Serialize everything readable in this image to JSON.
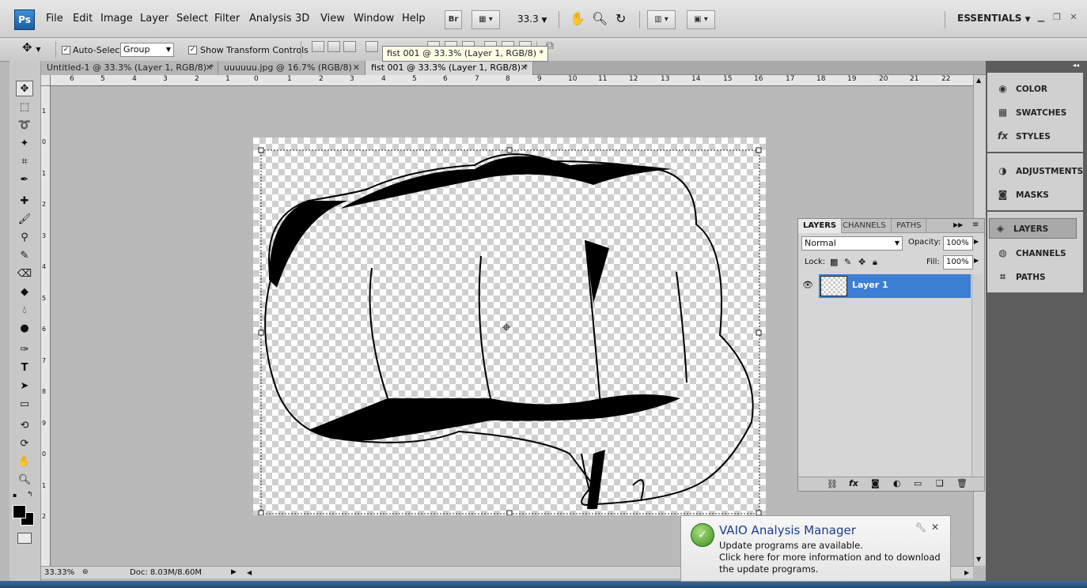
{
  "app": {
    "logo": "Ps",
    "workspace": "ESSENTIALS",
    "zoom_display": "33.3",
    "bridge_label": "Br"
  },
  "menu": [
    "File",
    "Edit",
    "Image",
    "Layer",
    "Select",
    "Filter",
    "Analysis",
    "3D",
    "View",
    "Window",
    "Help"
  ],
  "options": {
    "auto_select_label": "Auto-Select:",
    "auto_select_value": "Group",
    "transform_label": "Show Transform Controls"
  },
  "tooltip": "fist 001 @ 33.3% (Layer 1, RGB/8) *",
  "tabs": [
    {
      "label": "Untitled-1 @ 33.3% (Layer 1, RGB/8) *"
    },
    {
      "label": "uuuuuu.jpg @ 16.7% (RGB/8)"
    },
    {
      "label": "fist 001 @ 33.3% (Layer 1, RGB/8) *"
    }
  ],
  "ruler_top": [
    "6",
    "5",
    "4",
    "3",
    "2",
    "1",
    "0",
    "1",
    "2",
    "3",
    "4",
    "5",
    "6",
    "7",
    "8",
    "9",
    "10",
    "11",
    "12",
    "13",
    "14",
    "15",
    "16",
    "17",
    "18",
    "19",
    "20",
    "21",
    "22"
  ],
  "ruler_left": [
    "1",
    "0",
    "1",
    "2",
    "3",
    "4",
    "5",
    "6",
    "7",
    "8",
    "9",
    "0",
    "1",
    "2"
  ],
  "status": {
    "zoom": "33.33%",
    "doc": "Doc: 8.03M/8.60M"
  },
  "layers_panel": {
    "tabs": [
      "LAYERS",
      "CHANNELS",
      "PATHS"
    ],
    "blend_mode": "Normal",
    "opacity_label": "Opacity:",
    "opacity_value": "100%",
    "lock_label": "Lock:",
    "fill_label": "Fill:",
    "fill_value": "100%",
    "layer_name": "Layer 1"
  },
  "dock": {
    "group1": [
      {
        "label": "COLOR",
        "icon": "color-icon"
      },
      {
        "label": "SWATCHES",
        "icon": "swatches-icon"
      },
      {
        "label": "STYLES",
        "icon": "styles-icon"
      }
    ],
    "group2": [
      {
        "label": "ADJUSTMENTS",
        "icon": "adjustments-icon"
      },
      {
        "label": "MASKS",
        "icon": "masks-icon"
      }
    ],
    "group3": [
      {
        "label": "LAYERS",
        "icon": "layers-icon"
      },
      {
        "label": "CHANNELS",
        "icon": "channels-icon"
      },
      {
        "label": "PATHS",
        "icon": "paths-icon"
      }
    ]
  },
  "notification": {
    "title": "VAIO Analysis Manager",
    "line1": "Update programs are available.",
    "line2": "Click here for more information and to download the update programs."
  }
}
